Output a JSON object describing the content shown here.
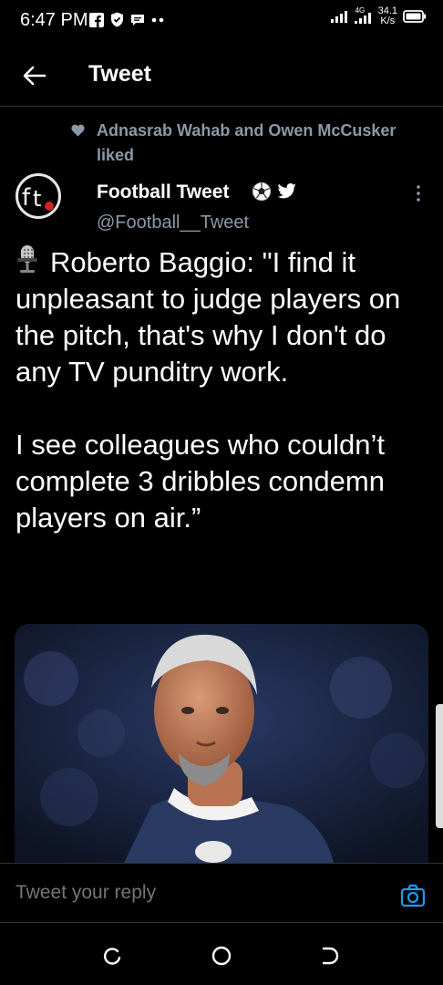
{
  "status_bar": {
    "time": "6:47 PM",
    "net_speed_value": "34.1",
    "net_speed_unit": "K/s",
    "net_type": "4G"
  },
  "header": {
    "title": "Tweet"
  },
  "social_context": {
    "text": "Adnasrab Wahab and Owen McCusker liked"
  },
  "tweet": {
    "author_name": "Football Tweet",
    "author_handle": "@Football__Tweet",
    "avatar_text": "ft",
    "name_icons": [
      "soccer-ball-icon",
      "twitter-bird-icon"
    ],
    "text": "Roberto Baggio: \"I find it unpleasant to judge players on the pitch, that's why I don't do any TV punditry work.\n\nI see colleagues who couldn’t complete 3 dribbles condemn players on air.”"
  },
  "reply": {
    "placeholder": "Tweet your reply"
  },
  "colors": {
    "background": "#000000",
    "secondary_text": "#8b98a5",
    "accent": "#1d9bf0",
    "divider": "#2f3336"
  }
}
